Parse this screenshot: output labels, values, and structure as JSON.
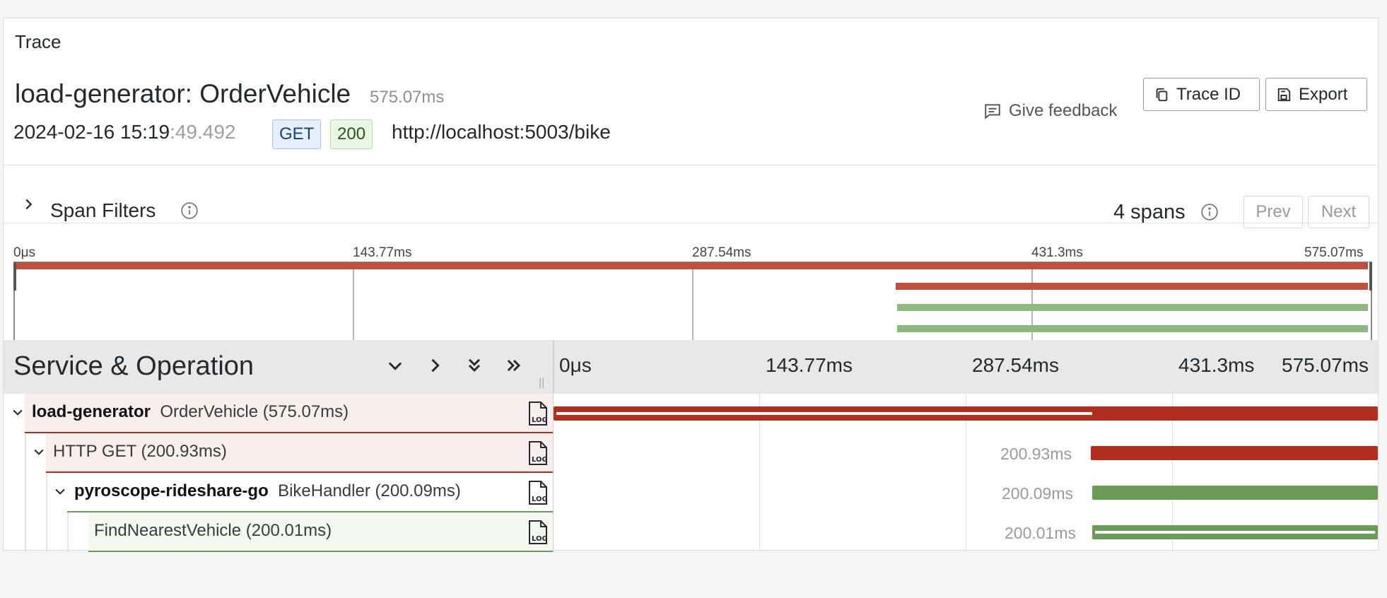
{
  "panel": {
    "title": "Trace"
  },
  "trace": {
    "name": "load-generator: OrderVehicle",
    "duration": "575.07ms",
    "date_main": "2024-02-16 15:19",
    "date_seconds": ":49.492",
    "method": "GET",
    "status": "200",
    "url": "http://localhost:5003/bike"
  },
  "actions": {
    "feedback": "Give feedback",
    "trace_id": "Trace ID",
    "export": "Export"
  },
  "filters": {
    "label": "Span Filters",
    "count": "4 spans",
    "prev": "Prev",
    "next": "Next"
  },
  "ticks": [
    "0μs",
    "143.77ms",
    "287.54ms",
    "431.3ms",
    "575.07ms"
  ],
  "header": {
    "title": "Service & Operation"
  },
  "spans": [
    {
      "service": "load-generator",
      "operation": "OrderVehicle (575.07ms)",
      "duration": "",
      "color": "#b22f1f"
    },
    {
      "service": "",
      "operation": "HTTP GET (200.93ms)",
      "duration": "200.93ms",
      "color": "#b22f1f"
    },
    {
      "service": "pyroscope-rideshare-go",
      "operation": "BikeHandler (200.09ms)",
      "duration": "200.09ms",
      "color": "#6a9c58"
    },
    {
      "service": "",
      "operation": "FindNearestVehicle (200.01ms)",
      "duration": "200.01ms",
      "color": "#6a9c58"
    }
  ],
  "colors": {
    "red": "#b22f1f",
    "green": "#6a9c58",
    "mini_red": "#c0503d",
    "mini_green": "#8fb77f"
  }
}
